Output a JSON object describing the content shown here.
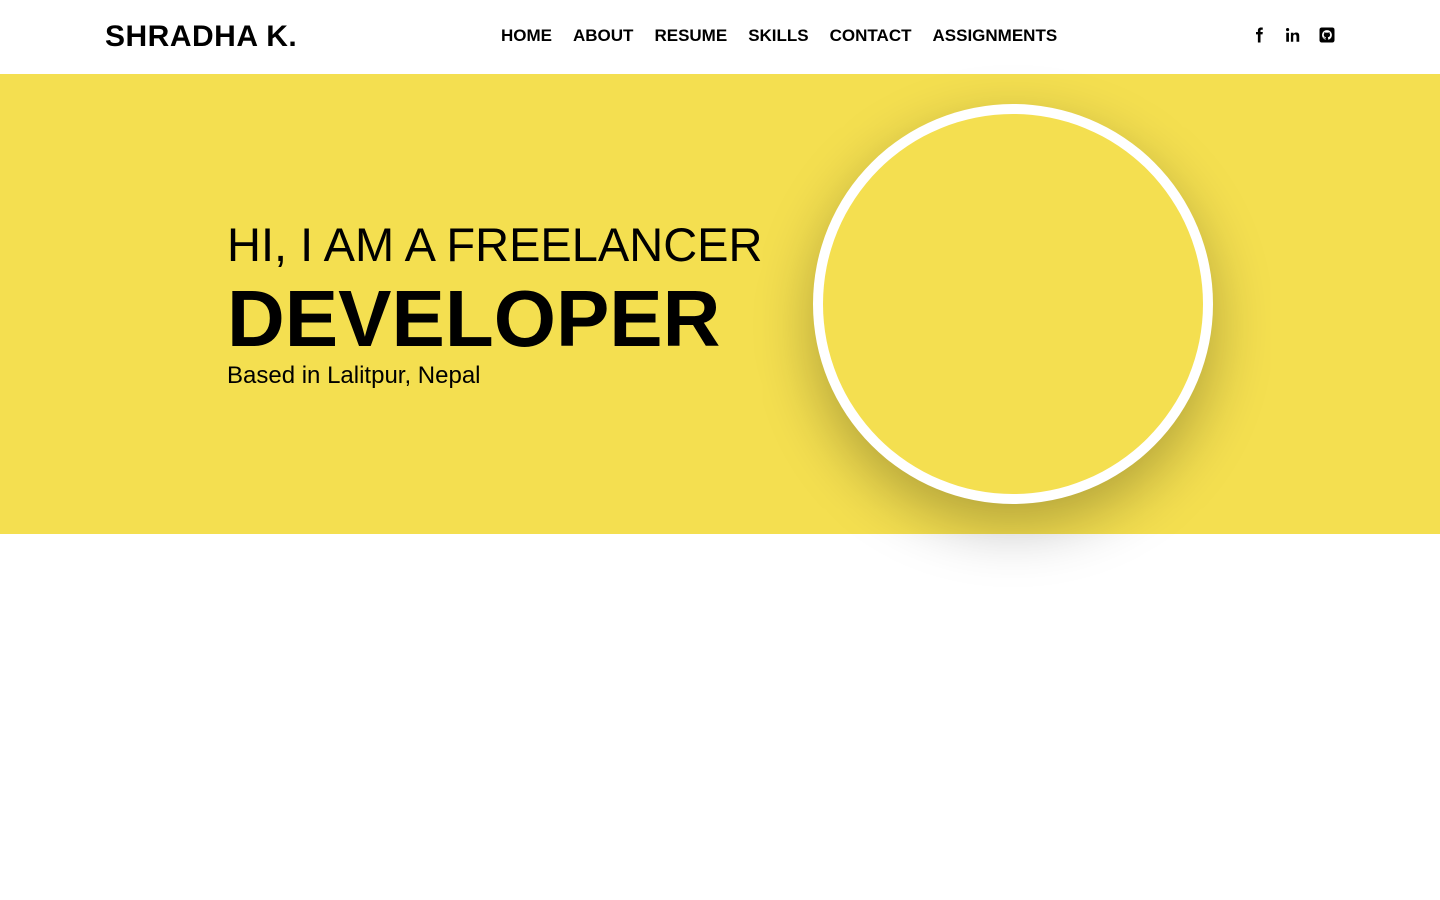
{
  "header": {
    "brand": "SHRADHA K.",
    "nav": [
      {
        "label": "HOME"
      },
      {
        "label": "ABOUT"
      },
      {
        "label": "RESUME"
      },
      {
        "label": "SKILLS"
      },
      {
        "label": "CONTACT"
      },
      {
        "label": "ASSIGNMENTS"
      }
    ],
    "social": [
      {
        "icon": "facebook-icon"
      },
      {
        "icon": "linkedin-icon"
      },
      {
        "icon": "github-icon"
      }
    ]
  },
  "hero": {
    "line1": "HI, I AM A FREELANCER",
    "line2": "DEVELOPER",
    "line3": "Based in Lalitpur, Nepal",
    "accent_color": "#f4df50"
  }
}
